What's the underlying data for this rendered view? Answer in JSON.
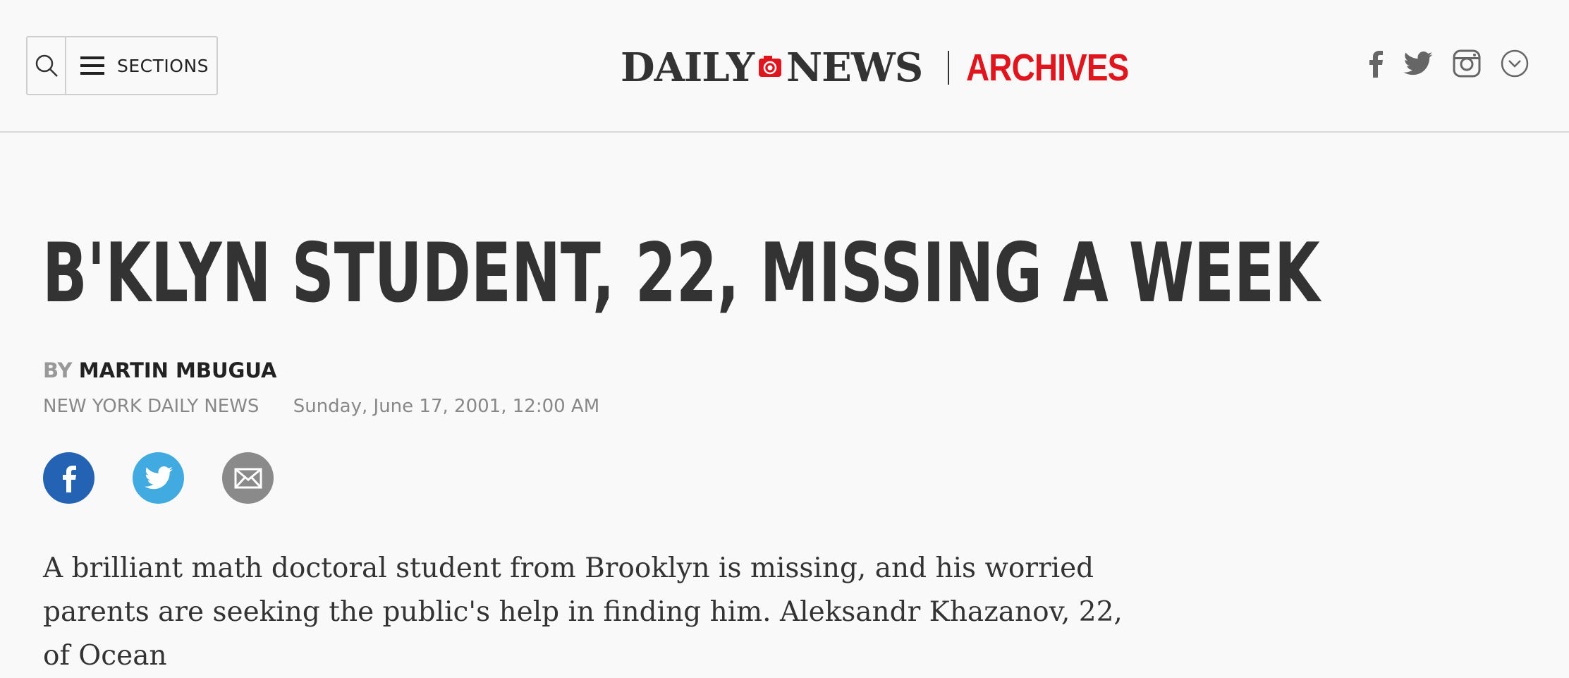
{
  "header": {
    "sections_label": "SECTIONS",
    "logo_left": "DAILY",
    "logo_right": "NEWS",
    "archives": "ARCHIVES",
    "social_icons": [
      "facebook-icon",
      "twitter-icon",
      "instagram-icon",
      "chevron-down-icon"
    ]
  },
  "article": {
    "headline": "B'KLYN STUDENT, 22, MISSING A WEEK",
    "by_prefix": "BY",
    "author": "MARTIN MBUGUA",
    "publication": "NEW YORK DAILY NEWS",
    "date": "Sunday, June 17, 2001, 12:00 AM",
    "share_icons": [
      "facebook-icon",
      "twitter-icon",
      "email-icon"
    ],
    "body": "A brilliant math doctoral student from Brooklyn is missing, and his worried parents are seeking the public's help in finding him. Aleksandr Khazanov, 22, of Ocean"
  },
  "colors": {
    "accent": "#e0151d",
    "facebook": "#2463b4",
    "twitter": "#41abe1",
    "email": "#8a8a8a"
  }
}
